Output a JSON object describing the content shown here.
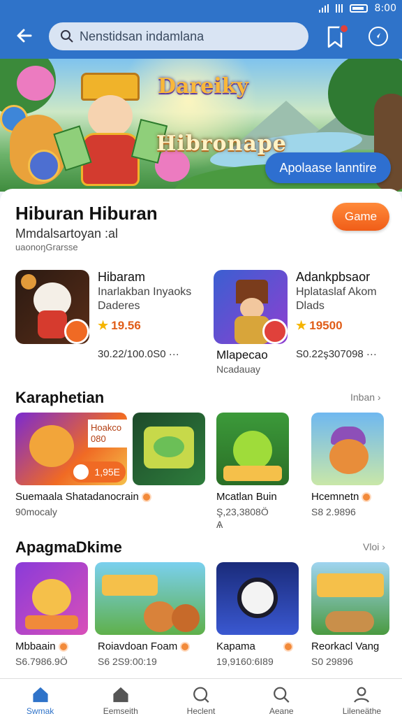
{
  "status": {
    "time": "8:00"
  },
  "header": {
    "search_text": "Nenstidsan indamlana"
  },
  "hero": {
    "logo_top": "Dareiky",
    "logo_main": "Hibronape",
    "cta": "Apolaase lanntire"
  },
  "section": {
    "title": "Hiburan Hiburan",
    "subtitle": "Mmdalsartoyan :al",
    "caption": "uaonoŋGrarsse",
    "pill": "Game"
  },
  "featured": [
    {
      "name": "Hibaram",
      "desc1": "Inarlakban Inyaoks",
      "desc2": "Daderes",
      "rating": "19.56",
      "price": "30.22/100.0S0 ···"
    },
    {
      "name": "Adankpbsaor",
      "desc1": "Hplataslaf Akom",
      "desc2": "Dlads",
      "rating": "19500",
      "price": "S0.22ş307098 ···",
      "extra1": "Mlapecao",
      "extra2": "Ncadauay"
    }
  ],
  "row1": {
    "title": "Karaphetian",
    "more": "Inban ›",
    "promo_text": "Hoakco 080",
    "promo_tag": "1,95E",
    "items": [
      {
        "name": "Suemaala Shatadanocrain",
        "price": "90mocaly"
      },
      {
        "name": "",
        "price": ""
      },
      {
        "name": "Mcatlan Buin",
        "price": "Ş,23,3808Ö"
      },
      {
        "name": "Hcemnetn",
        "price": "S8 2.9896"
      }
    ],
    "extra_price_line": "Ѧ"
  },
  "row2": {
    "title": "ApagmaDkime",
    "more": "Vloi ›",
    "items": [
      {
        "name": "Mbbaain",
        "price": "S6.7986.9Ö"
      },
      {
        "name": "Roiavdoan Foam",
        "price": "S6 2S9:00:19"
      },
      {
        "name": "Kapama",
        "price": "19,9160:6I89"
      },
      {
        "name": "Reorkacl Vang",
        "price": "S0 29896"
      }
    ]
  },
  "nav": [
    {
      "label": "Swmak",
      "icon": "home-icon"
    },
    {
      "label": "Eemseith",
      "icon": "home-outline-icon"
    },
    {
      "label": "Heclent",
      "icon": "search-icon"
    },
    {
      "label": "Aeane",
      "icon": "search-icon"
    },
    {
      "label": "Lileneäthe",
      "icon": "user-icon"
    }
  ],
  "colors": {
    "primary": "#2f73c9",
    "accent": "#f06a24",
    "star": "#f5b400"
  }
}
